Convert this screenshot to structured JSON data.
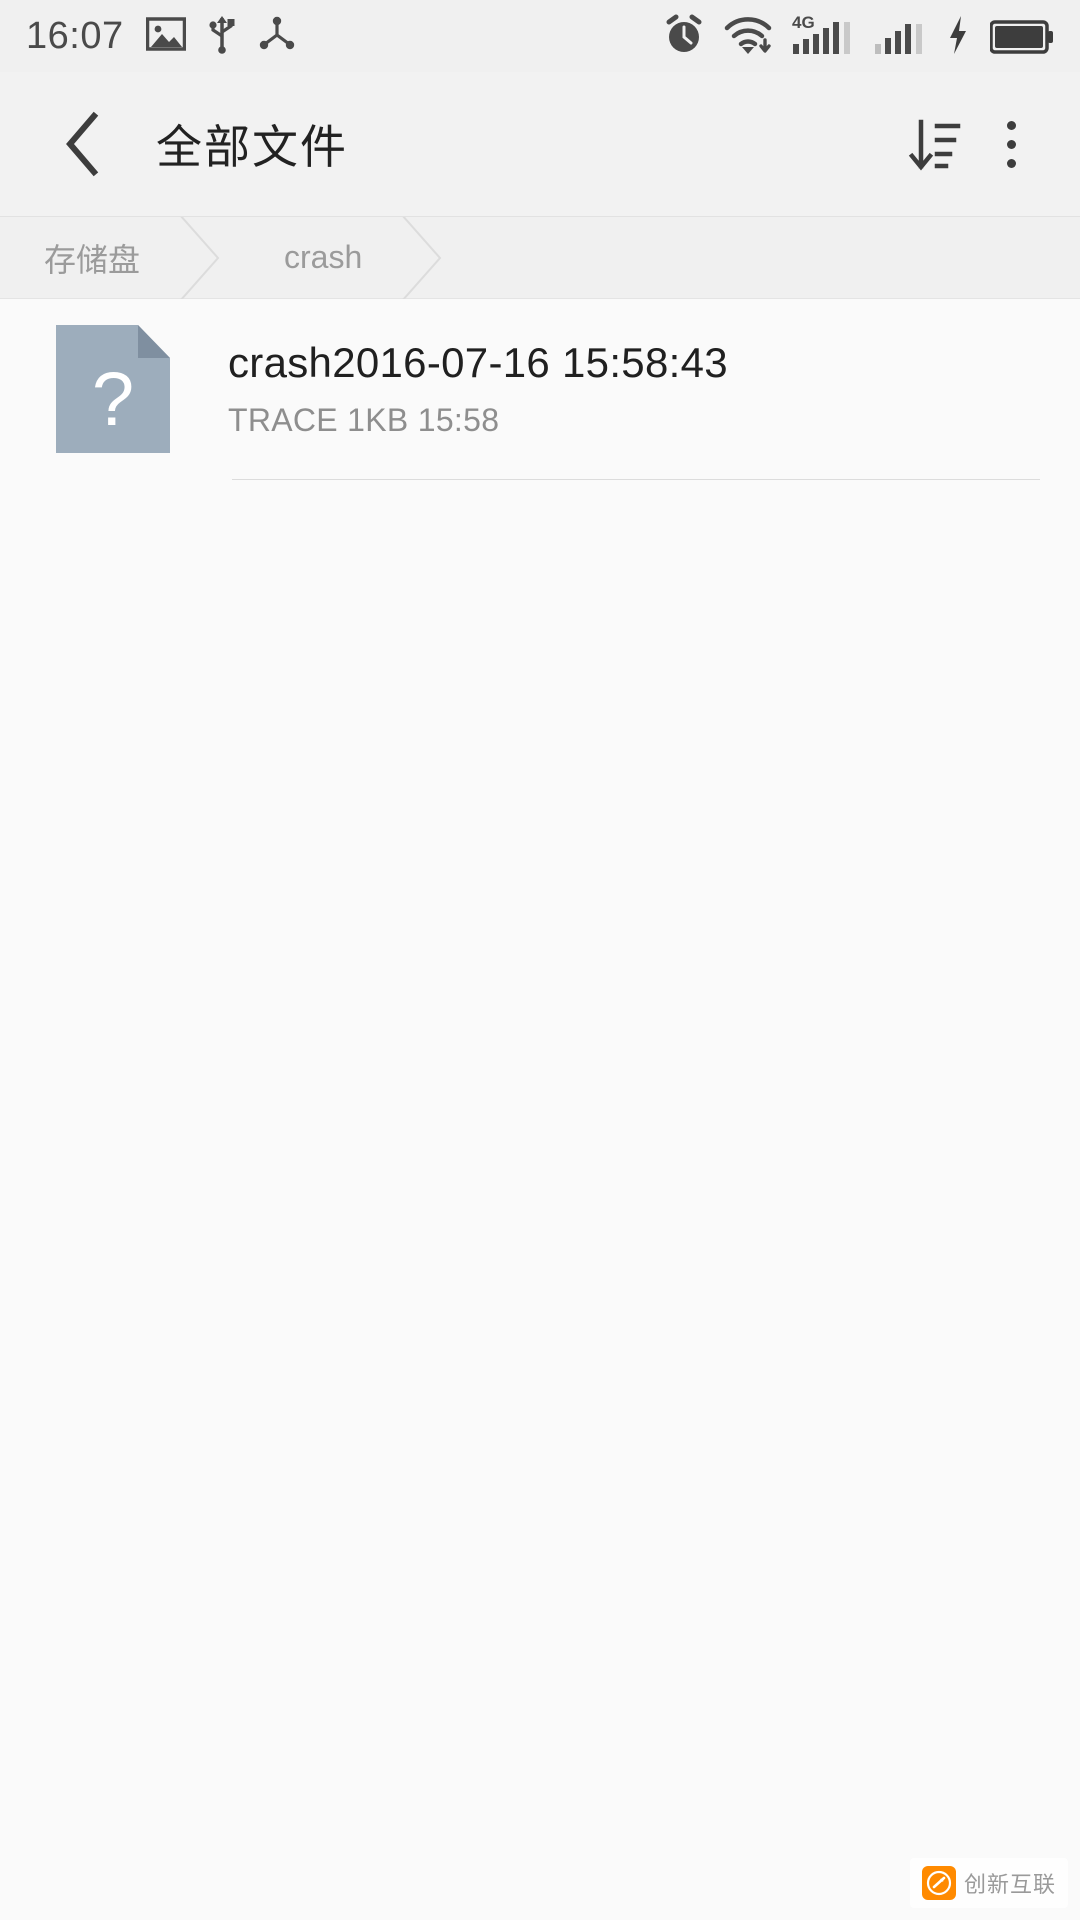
{
  "status_bar": {
    "time": "16:07",
    "left_icons": [
      {
        "name": "image-icon"
      },
      {
        "name": "usb-icon"
      },
      {
        "name": "share-nodes-icon"
      }
    ],
    "right_icons": [
      {
        "name": "alarm-clock-icon"
      },
      {
        "name": "wifi-download-icon"
      },
      {
        "name": "signal-4g-icon",
        "label": "4G"
      },
      {
        "name": "signal-bars-icon"
      },
      {
        "name": "charging-bolt-icon"
      },
      {
        "name": "battery-full-icon"
      }
    ],
    "network_label": "4G",
    "background": "#f0f0f0"
  },
  "action_bar": {
    "back_label": "‹",
    "title": "全部文件",
    "sort_button_name": "sort-icon",
    "overflow_button_name": "more-options-icon",
    "background": "#f2f2f2"
  },
  "breadcrumb": {
    "items": [
      {
        "label": "存储盘"
      },
      {
        "label": "crash"
      }
    ],
    "text_color": "#9b9b9b"
  },
  "file_list": {
    "rows": [
      {
        "name": "crash2016-07-16 15:58:43",
        "type": "TRACE",
        "size": "1KB",
        "time": "15:58",
        "subtitle": "TRACE  1KB  15:58",
        "icon": "unknown-file-icon",
        "icon_color": "#9dadbc",
        "icon_glyph": "?"
      }
    ]
  },
  "watermark": {
    "text": "创新互联"
  },
  "colors": {
    "page_background": "#fafafa",
    "divider": "#dcdcdc",
    "primary_text": "#202020",
    "secondary_text": "#8e8e8e"
  }
}
